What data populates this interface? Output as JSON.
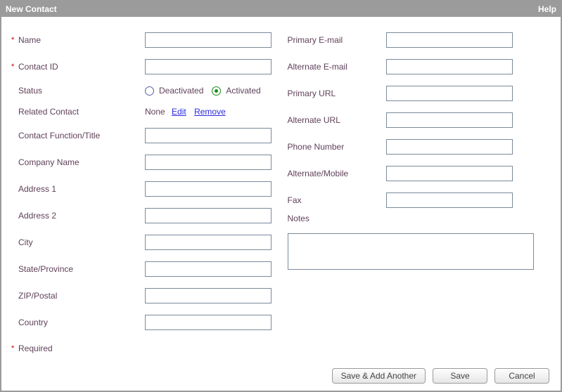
{
  "titlebar": {
    "title": "New Contact",
    "help": "Help"
  },
  "left": {
    "name_label": "Name",
    "contact_id_label": "Contact ID",
    "status_label": "Status",
    "status_deactivated": "Deactivated",
    "status_activated": "Activated",
    "status_value": "Activated",
    "related_label": "Related Contact",
    "related_value": "None",
    "related_edit": "Edit",
    "related_remove": "Remove",
    "function_label": "Contact Function/Title",
    "company_label": "Company Name",
    "address1_label": "Address 1",
    "address2_label": "Address 2",
    "city_label": "City",
    "state_label": "State/Province",
    "zip_label": "ZIP/Postal",
    "country_label": "Country",
    "required_note": "Required",
    "req_mark": "*"
  },
  "right": {
    "primary_email_label": "Primary E-mail",
    "alt_email_label": "Alternate E-mail",
    "primary_url_label": "Primary URL",
    "alt_url_label": "Alternate URL",
    "phone_label": "Phone Number",
    "alt_mobile_label": "Alternate/Mobile",
    "fax_label": "Fax",
    "notes_label": "Notes"
  },
  "buttons": {
    "save_add": "Save & Add Another",
    "save": "Save",
    "cancel": "Cancel"
  },
  "values": {
    "name": "",
    "contact_id": "",
    "function": "",
    "company": "",
    "address1": "",
    "address2": "",
    "city": "",
    "state": "",
    "zip": "",
    "country": "",
    "primary_email": "",
    "alt_email": "",
    "primary_url": "",
    "alt_url": "",
    "phone": "",
    "alt_mobile": "",
    "fax": "",
    "notes": ""
  }
}
